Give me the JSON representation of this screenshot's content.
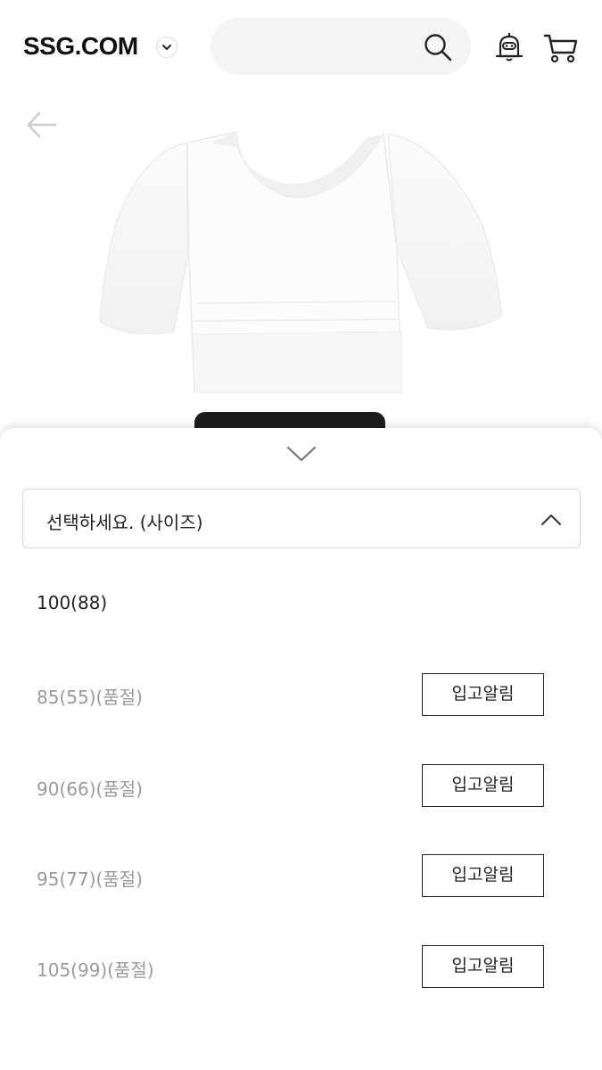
{
  "header": {
    "logo": "SSG.COM",
    "icons": {
      "logo_menu": "chevron-down-icon",
      "search": "search-icon",
      "alert": "bell-icon",
      "cart": "cart-icon"
    }
  },
  "product": {
    "back_icon": "arrow-left-icon",
    "image": "white-puff-sleeve-crop-top"
  },
  "sheet": {
    "collapse_icon": "chevron-down-icon",
    "select": {
      "label": "선택하세요. (사이즈)",
      "icon": "chevron-up-icon"
    },
    "options": [
      {
        "label": "100(88)",
        "status": "available",
        "button": ""
      },
      {
        "label": "85(55)(품절)",
        "status": "soldout",
        "button": "입고알림"
      },
      {
        "label": "90(66)(품절)",
        "status": "soldout",
        "button": "입고알림"
      },
      {
        "label": "95(77)(품절)",
        "status": "soldout",
        "button": "입고알림"
      },
      {
        "label": "105(99)(품절)",
        "status": "soldout",
        "button": "입고알림"
      }
    ]
  },
  "colors": {
    "text": "#222222",
    "muted": "#9a9a9a",
    "search_bg": "#f4f4f4",
    "border": "#d6d6d6"
  }
}
